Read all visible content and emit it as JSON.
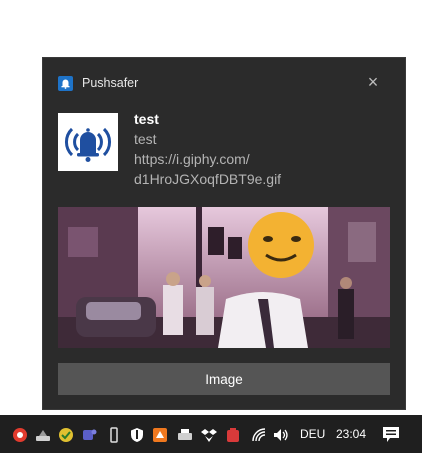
{
  "notification": {
    "app_name": "Pushsafer",
    "close_glyph": "×",
    "title": "test",
    "body_lines": [
      "test",
      "https://i.giphy.com/",
      "d1HroJGXoqfDBT9e.gif"
    ],
    "app_icon": "bell-broadcast-icon",
    "hero_image": "animated-gif-preview",
    "action_button_label": "Image"
  },
  "taskbar": {
    "language": "DEU",
    "time": "23:04",
    "tray_icons": [
      "chrome-like-icon",
      "drive-icon",
      "shield-check-icon",
      "teams-icon",
      "usb-icon",
      "security-icon",
      "orange-app-icon",
      "printer-icon",
      "dropbox-icon",
      "red-app-icon",
      "wifi-icon",
      "volume-icon"
    ],
    "action_center_icon": "action-center-icon"
  },
  "colors": {
    "toast_bg": "#2b2b2b",
    "button_bg": "#555555",
    "taskbar_bg": "#1f1f1f",
    "brand_blue": "#1e73c8"
  }
}
